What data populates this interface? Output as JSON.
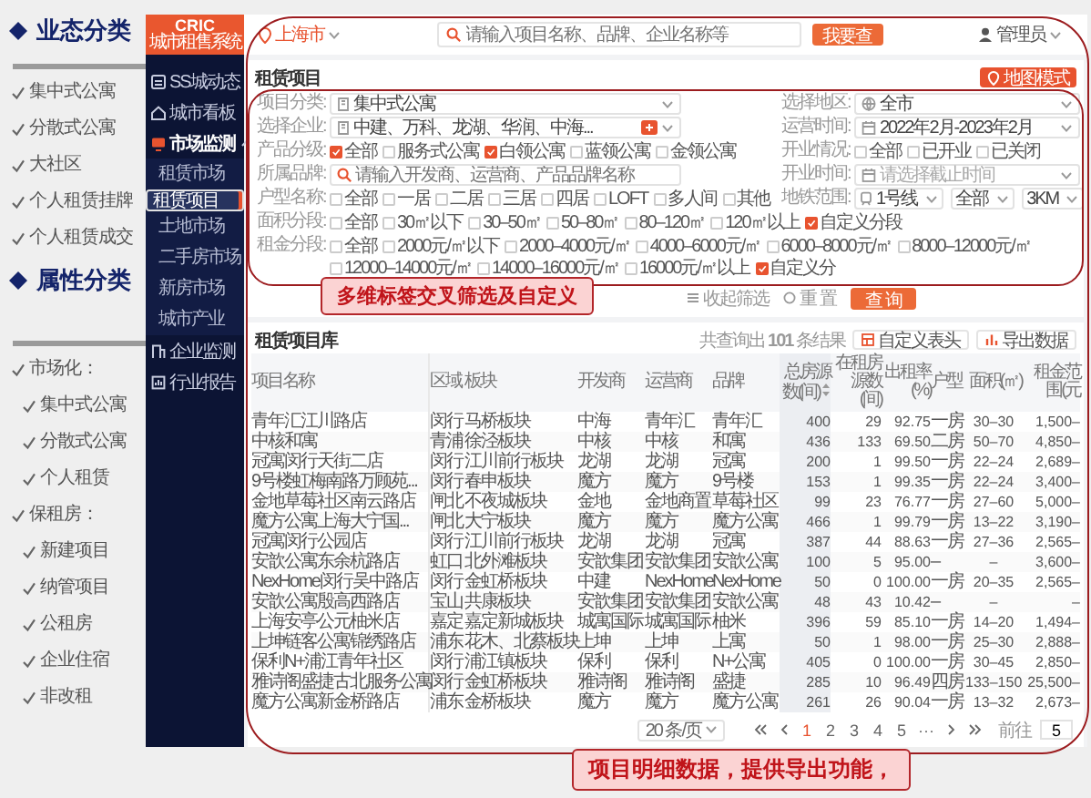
{
  "slide": {
    "sections": [
      {
        "heading": "业态分类",
        "items": [
          {
            "label": "集中式公寓"
          },
          {
            "label": "分散式公寓"
          },
          {
            "label": "大社区"
          },
          {
            "label": "个人租赁挂牌"
          },
          {
            "label": "个人租赁成交"
          }
        ]
      },
      {
        "heading": "属性分类",
        "items": [
          {
            "label": "市场化：",
            "children": [
              {
                "label": "集中式公寓"
              },
              {
                "label": "分散式公寓"
              },
              {
                "label": "个人租赁"
              }
            ]
          },
          {
            "label": "保租房：",
            "children": [
              {
                "label": "新建项目"
              },
              {
                "label": "纳管项目"
              },
              {
                "label": "公租房"
              },
              {
                "label": "企业住宿"
              },
              {
                "label": "非改租"
              }
            ]
          }
        ]
      }
    ]
  },
  "app": {
    "logo": {
      "title": "CRIC",
      "subtitle": "城市租售系统"
    },
    "city": "上海市",
    "search": {
      "placeholder": "请输入项目名称、品牌、企业名称等",
      "button": "我要查"
    },
    "user": "管理员",
    "sidebar": [
      {
        "label": "SS城动态",
        "selected": false
      },
      {
        "label": "城市看板",
        "selected": false
      },
      {
        "label": "市场监测",
        "selected": false,
        "expanded": true,
        "children": [
          {
            "label": "租赁市场",
            "selected": false
          },
          {
            "label": "租赁项目",
            "selected": true
          },
          {
            "label": "土地市场",
            "selected": false
          },
          {
            "label": "二手房市场",
            "selected": false
          },
          {
            "label": "新房市场",
            "selected": false
          },
          {
            "label": "城市产业",
            "selected": false
          }
        ]
      },
      {
        "label": "企业监测",
        "selected": false
      },
      {
        "label": "行业报告",
        "selected": false
      }
    ],
    "filter_panel": {
      "title": "租赁项目",
      "map_button": "地图模式",
      "rows": [
        {
          "fields": [
            {
              "kind": "select",
              "label": "项目分类:",
              "value": "集中式公寓"
            },
            {
              "kind": "select",
              "label": "选择地区:",
              "value": "全市"
            }
          ]
        },
        {
          "fields": [
            {
              "kind": "tag-select",
              "label": "选择企业:",
              "value": "中建、万科、龙湖、华润、中海..."
            },
            {
              "kind": "select",
              "label": "运营时间:",
              "value": "2022年2月-2023年2月"
            }
          ]
        },
        {
          "fields": [
            {
              "kind": "checks",
              "label": "产品分级:",
              "options": [
                {
                  "label": "全部",
                  "checked": true
                },
                {
                  "label": "服务式公寓",
                  "checked": false
                },
                {
                  "label": "白领公寓",
                  "checked": true
                },
                {
                  "label": "蓝领公寓",
                  "checked": false
                },
                {
                  "label": "金领公寓",
                  "checked": false
                }
              ]
            },
            {
              "kind": "checks",
              "label": "开业情况:",
              "options": [
                {
                  "label": "全部",
                  "checked": false
                },
                {
                  "label": "已开业",
                  "checked": false
                },
                {
                  "label": "已关闭",
                  "checked": false
                }
              ]
            }
          ]
        },
        {
          "fields": [
            {
              "kind": "text",
              "label": "所属品牌:",
              "placeholder": "请输入开发商、运营商、产品品牌名称"
            },
            {
              "kind": "select",
              "label": "开业时间:",
              "placeholder": "请选择截止时间"
            }
          ]
        },
        {
          "fields": [
            {
              "kind": "checks",
              "label": "户型名称:",
              "options": [
                {
                  "label": "全部",
                  "checked": false
                },
                {
                  "label": "一居",
                  "checked": false
                },
                {
                  "label": "二居",
                  "checked": false
                },
                {
                  "label": "三居",
                  "checked": false
                },
                {
                  "label": "四居",
                  "checked": false
                },
                {
                  "label": "LOFT",
                  "checked": false
                },
                {
                  "label": "多人间",
                  "checked": false
                },
                {
                  "label": "其他",
                  "checked": false
                }
              ]
            },
            {
              "kind": "selects",
              "label": "地铁范围:",
              "values": [
                "1号线",
                "全部",
                "3KM"
              ]
            }
          ]
        },
        {
          "fields": [
            {
              "kind": "checks",
              "label": "面积分段:",
              "options": [
                {
                  "label": "全部",
                  "checked": false
                },
                {
                  "label": "30㎡以下",
                  "checked": false
                },
                {
                  "label": "30–50㎡",
                  "checked": false
                },
                {
                  "label": "50–80㎡",
                  "checked": false
                },
                {
                  "label": "80–120㎡",
                  "checked": false
                },
                {
                  "label": "120㎡以上",
                  "checked": false
                },
                {
                  "label": "自定义分段",
                  "checked": true
                }
              ]
            }
          ]
        },
        {
          "fields": [
            {
              "kind": "checks",
              "label": "租金分段:",
              "options": [
                {
                  "label": "全部",
                  "checked": false
                },
                {
                  "label": "2000元/㎡以下",
                  "checked": false
                },
                {
                  "label": "2000–4000元/㎡",
                  "checked": false
                },
                {
                  "label": "4000–6000元/㎡",
                  "checked": false
                },
                {
                  "label": "6000–8000元/㎡",
                  "checked": false
                },
                {
                  "label": "8000–12000元/㎡",
                  "checked": false
                },
                {
                  "label": "12000–14000元/㎡",
                  "checked": false
                },
                {
                  "label": "14000–16000元/㎡",
                  "checked": false
                },
                {
                  "label": "16000元/㎡以上",
                  "checked": false
                },
                {
                  "label": "自定义分",
                  "checked": true
                }
              ]
            }
          ]
        }
      ],
      "collapse_button": "收起筛选",
      "reset_button": "重 置",
      "query_button": "查 询",
      "callout": "多维标签交叉筛选及自定义"
    },
    "table_panel": {
      "title": "租赁项目库",
      "result": "共查询出 **101** 条结果",
      "custom_button": "自定义表头",
      "export_button": "导出数据",
      "columns": [
        {
          "label": "项目名称",
          "sorted": false
        },
        {
          "label": "区域",
          "sorted": false
        },
        {
          "label": "板块",
          "sorted": false
        },
        {
          "label": "开发商",
          "sorted": false
        },
        {
          "label": "运营商",
          "sorted": false
        },
        {
          "label": "品牌",
          "sorted": false
        },
        {
          "label": "总房源数(间)",
          "sorted": true
        },
        {
          "label": "在租房源数(间)",
          "sorted": false
        },
        {
          "label": "出租率(%)",
          "sorted": false
        },
        {
          "label": "户型",
          "sorted": false
        },
        {
          "label": "面积(㎡)",
          "sorted": false
        },
        {
          "label": "租金范围(元",
          "sorted": false
        }
      ],
      "rows": [
        [
          "青年汇江川路店",
          "闵行",
          "马桥板块",
          "中海",
          "青年汇",
          "青年汇",
          "400",
          "29",
          "92.75",
          "一房",
          "30–30",
          "1,500–"
        ],
        [
          "中核和寓",
          "青浦",
          "徐泾板块",
          "中核",
          "中核",
          "和寓",
          "436",
          "133",
          "69.50",
          "二房",
          "50–70",
          "4,850–"
        ],
        [
          "冠寓闵行天街二店",
          "闵行",
          "江川前行板块",
          "龙湖",
          "龙湖",
          "冠寓",
          "200",
          "1",
          "99.50",
          "一房",
          "22–24",
          "2,689–"
        ],
        [
          "9号楼虹梅南路万顾苑...",
          "闵行",
          "春申板块",
          "魔方",
          "魔方",
          "9号楼",
          "153",
          "1",
          "99.35",
          "一房",
          "22–24",
          "3,400–"
        ],
        [
          "金地草莓社区南云路店",
          "闸北",
          "不夜城板块",
          "金地",
          "金地商置",
          "草莓社区",
          "99",
          "23",
          "76.77",
          "一房",
          "27–60",
          "5,000–"
        ],
        [
          "魔方公寓上海大宁国...",
          "闸北",
          "大宁板块",
          "魔方",
          "魔方",
          "魔方公寓",
          "466",
          "1",
          "99.79",
          "一房",
          "13–22",
          "3,190–"
        ],
        [
          "冠寓闵行公园店",
          "闵行",
          "江川前行板块",
          "龙湖",
          "龙湖",
          "冠寓",
          "387",
          "44",
          "88.63",
          "一房",
          "27–36",
          "2,565–"
        ],
        [
          "安歆公寓东余杭路店",
          "虹口",
          "北外滩板块",
          "安歆集团",
          "安歆集团",
          "安歆公寓",
          "100",
          "5",
          "95.00",
          "–",
          "–",
          "3,600–"
        ],
        [
          "NexHome闵行吴中路店",
          "闵行",
          "金虹桥板块",
          "中建",
          "NexHome",
          "NexHome",
          "50",
          "0",
          "100.00",
          "一房",
          "20–35",
          "2,565–"
        ],
        [
          "安歆公寓殷高西路店",
          "宝山",
          "共康板块",
          "安歆集团",
          "安歆集团",
          "安歆公寓",
          "48",
          "43",
          "10.42",
          "–",
          "–",
          "–"
        ],
        [
          "上海安亭公元柚米店",
          "嘉定",
          "嘉定新城板块",
          "城寓国际",
          "城寓国际",
          "柚米",
          "396",
          "59",
          "85.10",
          "一房",
          "14–20",
          "1,494–"
        ],
        [
          "上坤链客公寓锦绣路店",
          "浦东",
          "花木、北蔡板块",
          "上坤",
          "上坤",
          "上寓",
          "50",
          "1",
          "98.00",
          "一房",
          "25–30",
          "2,888–"
        ],
        [
          "保利N+浦江青年社区",
          "闵行",
          "浦江镇板块",
          "保利",
          "保利",
          "N+公寓",
          "405",
          "0",
          "100.00",
          "一房",
          "30–45",
          "2,850–"
        ],
        [
          "雅诗阁盛捷古北服务公寓",
          "闵行",
          "金虹桥板块",
          "雅诗阁",
          "雅诗阁",
          "盛捷",
          "285",
          "10",
          "96.49",
          "四房",
          "133–150",
          "25,500–"
        ],
        [
          "魔方公寓新金桥路店",
          "浦东",
          "金桥板块",
          "魔方",
          "魔方",
          "魔方公寓",
          "261",
          "26",
          "90.04",
          "一房",
          "13–32",
          "2,673–"
        ]
      ],
      "pager": {
        "page_size": "20 条/页",
        "pages": [
          {
            "label": "1",
            "selected": true
          },
          {
            "label": "2",
            "selected": false
          },
          {
            "label": "3",
            "selected": false
          },
          {
            "label": "4",
            "selected": false
          },
          {
            "label": "5",
            "selected": false
          },
          {
            "label": "···",
            "selected": false
          }
        ],
        "goto_label": "前往",
        "goto_value": "5"
      },
      "callout": "项目明细数据，提供导出功能，"
    }
  }
}
